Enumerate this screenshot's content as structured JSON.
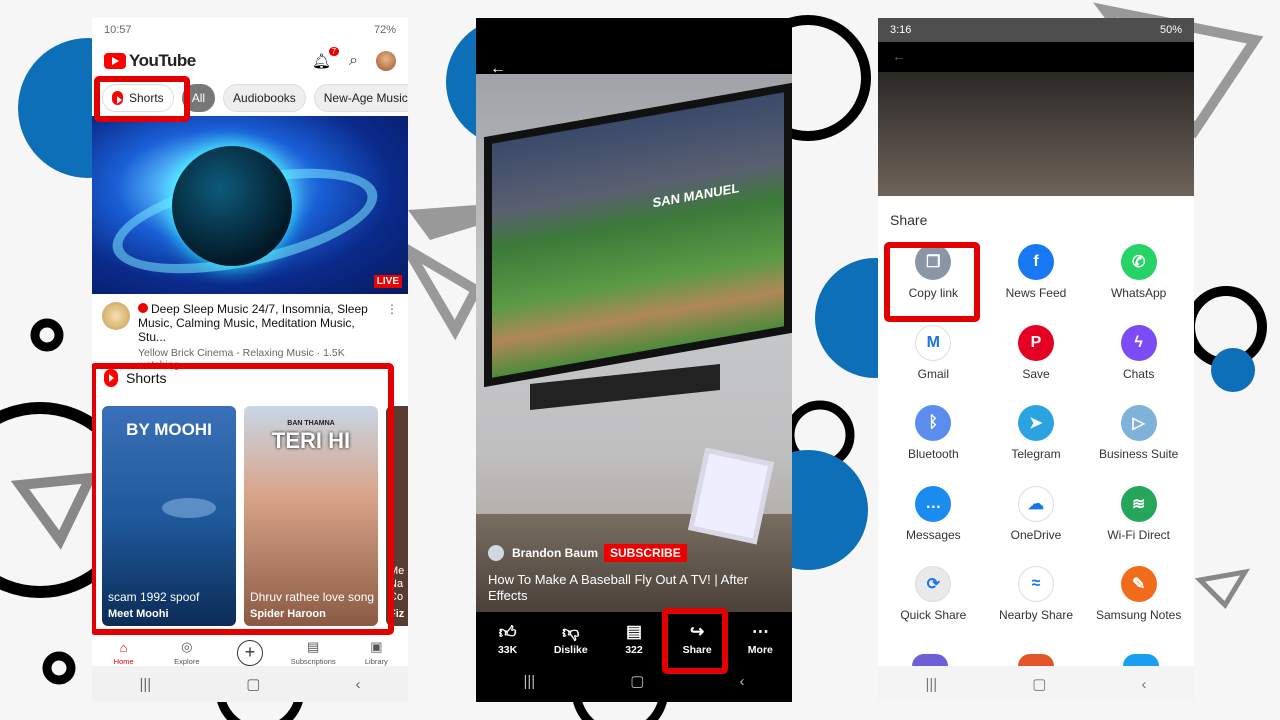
{
  "phone_left": {
    "status": {
      "time": "10:57",
      "battery": "72%"
    },
    "header": {
      "logo": "YouTube",
      "notification_count": "7"
    },
    "chips": [
      "Shorts",
      "All",
      "Audiobooks",
      "New-Age Music"
    ],
    "hero": {
      "badge": "LIVE"
    },
    "video": {
      "title": "Deep Sleep Music 24/7, Insomnia, Sleep Music, Calming Music, Meditation Music, Stu...",
      "meta": "Yellow Brick Cinema - Relaxing Music · 1.5K watching"
    },
    "shorts": {
      "heading": "Shorts",
      "items": [
        {
          "title": "scam 1992 spoof",
          "channel": "Meet Moohi",
          "overlay": "BY MOOHI"
        },
        {
          "title": "Dhruv rathee love song",
          "channel": "Spider Haroon",
          "overlay": "TERI HI",
          "overlay_small": "BAN THAMNA"
        }
      ],
      "peek": {
        "title": "Me Na Co",
        "channel": "Fiz"
      }
    },
    "bottom_nav": [
      "Home",
      "Explore",
      "",
      "Subscriptions",
      "Library"
    ]
  },
  "phone_middle": {
    "channel": "Brandon Baum",
    "subscribe": "SUBSCRIBE",
    "title": "How To  Make A Baseball Fly Out A TV! | After Effects",
    "tv_text": "SAN MANUEL",
    "actions": [
      {
        "label": "33K",
        "icon": "like-icon"
      },
      {
        "label": "Dislike",
        "icon": "dislike-icon"
      },
      {
        "label": "322",
        "icon": "comment-icon"
      },
      {
        "label": "Share",
        "icon": "share-icon"
      },
      {
        "label": "More",
        "icon": "more-icon"
      }
    ]
  },
  "phone_right": {
    "status": {
      "time": "3:16",
      "battery": "50%"
    },
    "share_title": "Share",
    "apps": [
      {
        "label": "Copy link",
        "icon": "copy-link-icon",
        "color": "#8a96a6",
        "glyph": "❐"
      },
      {
        "label": "News Feed",
        "icon": "facebook-icon",
        "color": "#1877f2",
        "glyph": "f"
      },
      {
        "label": "WhatsApp",
        "icon": "whatsapp-icon",
        "color": "#25d366",
        "glyph": "✆"
      },
      {
        "label": "Gmail",
        "icon": "gmail-icon",
        "color": "#ffffff",
        "glyph": "M"
      },
      {
        "label": "Save",
        "icon": "pinterest-icon",
        "color": "#e60023",
        "glyph": "P"
      },
      {
        "label": "Chats",
        "icon": "messenger-icon",
        "color": "#7b4cf5",
        "glyph": "ϟ"
      },
      {
        "label": "Bluetooth",
        "icon": "bluetooth-icon",
        "color": "#5b8def",
        "glyph": "ᛒ"
      },
      {
        "label": "Telegram",
        "icon": "telegram-icon",
        "color": "#2aa3e0",
        "glyph": "➤"
      },
      {
        "label": "Business Suite",
        "icon": "business-suite-icon",
        "color": "#7fb2d9",
        "glyph": "▷"
      },
      {
        "label": "Messages",
        "icon": "messages-icon",
        "color": "#1a8cf0",
        "glyph": "…"
      },
      {
        "label": "OneDrive",
        "icon": "onedrive-icon",
        "color": "#ffffff",
        "glyph": "☁"
      },
      {
        "label": "Wi-Fi Direct",
        "icon": "wifi-direct-icon",
        "color": "#26a65b",
        "glyph": "≋"
      },
      {
        "label": "Quick Share",
        "icon": "quick-share-icon",
        "color": "#e9e9e9",
        "glyph": "⟳"
      },
      {
        "label": "Nearby Share",
        "icon": "nearby-share-icon",
        "color": "#ffffff",
        "glyph": "≈"
      },
      {
        "label": "Samsung Notes",
        "icon": "samsung-notes-icon",
        "color": "#f26a1b",
        "glyph": "✎"
      }
    ]
  },
  "accent": "#e30000"
}
